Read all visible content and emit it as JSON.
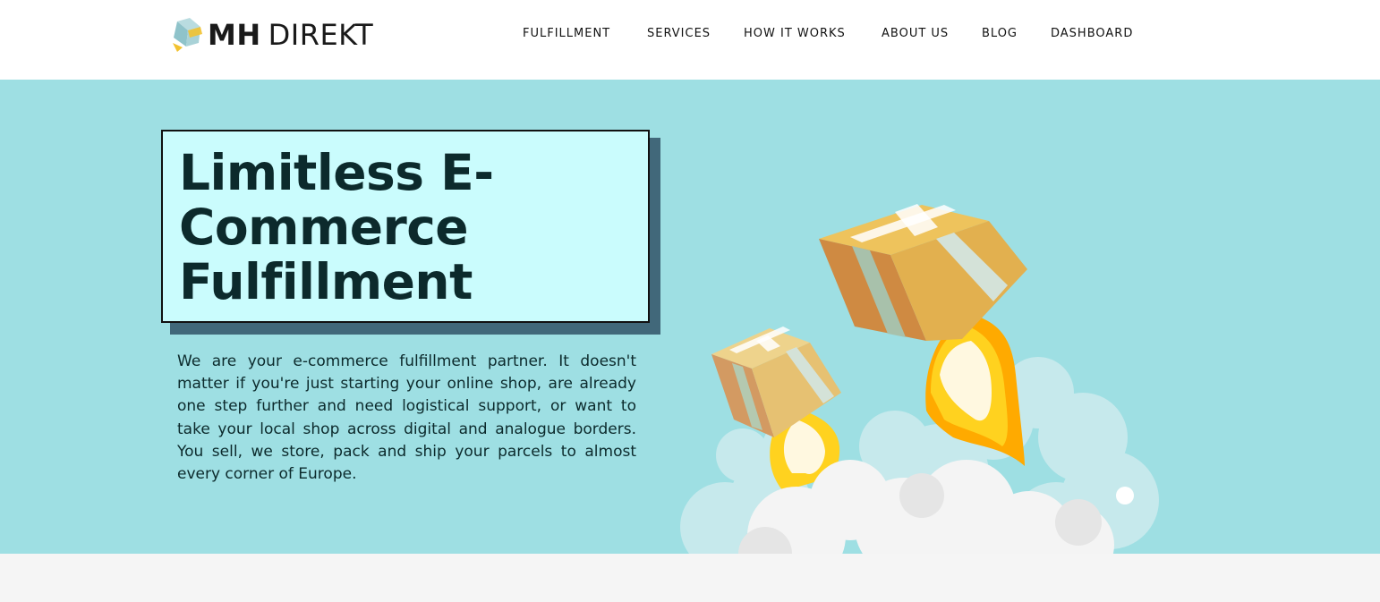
{
  "header": {
    "logo": {
      "brand_bold": "MH",
      "brand_light": "DIREKT"
    },
    "nav": [
      {
        "label": "FULFILLMENT"
      },
      {
        "label": "SERVICES"
      },
      {
        "label": "HOW IT WORKS"
      },
      {
        "label": "ABOUT US"
      },
      {
        "label": "BLOG"
      },
      {
        "label": "DASHBOARD"
      }
    ]
  },
  "hero": {
    "title_lines": [
      "Limitless E-",
      "Commerce",
      "Fulfillment"
    ],
    "description": "We are your e-commerce fulfillment partner. It doesn't matter if you're just starting your online shop, are already one step further and need logistical support, or want to take your local shop across digital and analogue borders. You sell, we store, pack and ship your parcels to almost every corner of Europe.",
    "illustration": "rocket-boxes-illustration"
  },
  "colors": {
    "hero_bg": "#9edfe3",
    "title_box_bg": "#cafcfd",
    "title_shadow": "#41687a",
    "text_dark": "#0c2a2c",
    "box_orange": "#e2b04f",
    "flame_yellow": "#ffd21f"
  }
}
